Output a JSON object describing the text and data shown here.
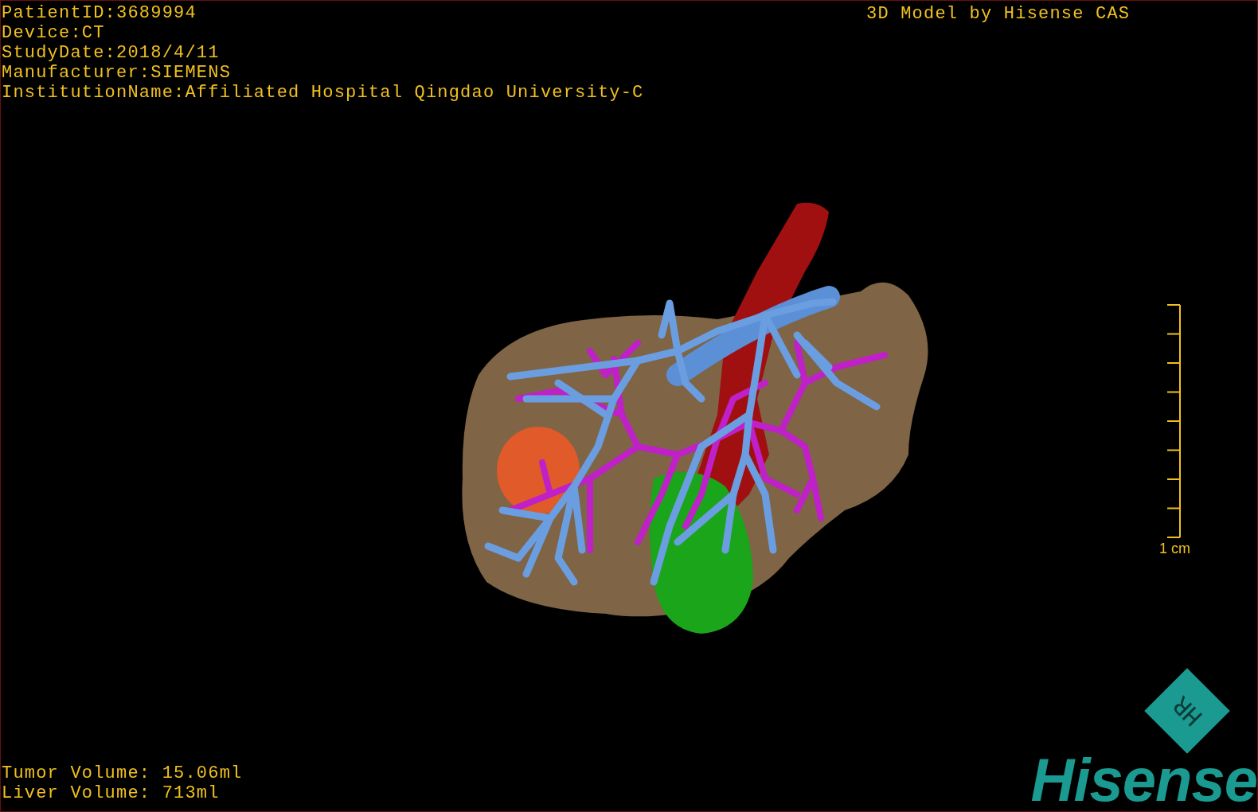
{
  "study_info": [
    "PatientID:3689994",
    "Device:CT",
    "StudyDate:2018/4/11",
    "Manufacturer:SIEMENS",
    "InstitutionName:Affiliated Hospital Qingdao University-C"
  ],
  "title": "3D Model by Hisense CAS",
  "scale_bar": {
    "label": "1 cm"
  },
  "volumes": [
    "Tumor Volume: 15.06ml",
    "Liver Volume: 713ml"
  ],
  "logo": {
    "badge": "HR",
    "wordmark": "Hisense"
  }
}
